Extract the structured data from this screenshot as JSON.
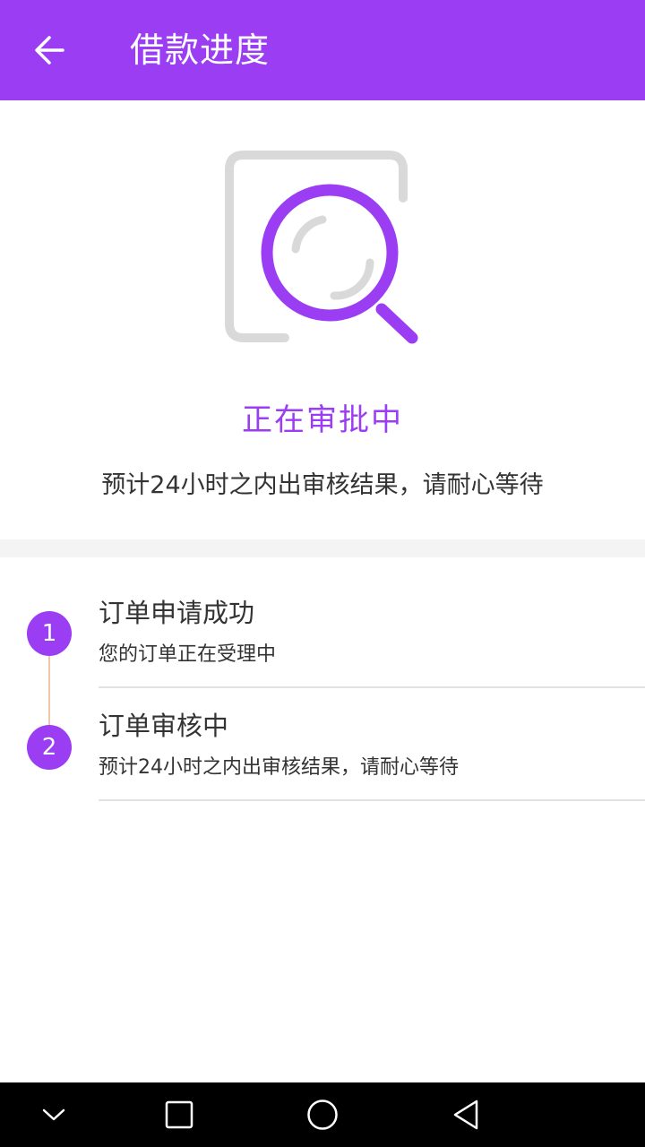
{
  "header": {
    "title": "借款进度",
    "back_icon": "arrow-left-icon"
  },
  "status": {
    "icon": "search-review-icon",
    "title": "正在审批中",
    "description": "预计24小时之内出审核结果，请耐心等待"
  },
  "steps": [
    {
      "number": "1",
      "title": "订单申请成功",
      "description": "您的订单正在受理中"
    },
    {
      "number": "2",
      "title": "订单审核中",
      "description": "预计24小时之内出审核结果，请耐心等待"
    }
  ],
  "navbar": {
    "icons": [
      "chevron-down-icon",
      "square-icon",
      "circle-icon",
      "triangle-back-icon"
    ]
  },
  "colors": {
    "primary": "#9b3ef3",
    "icon_gray": "#d9d9d9",
    "timeline": "#f3c7a6",
    "text": "#333333"
  }
}
